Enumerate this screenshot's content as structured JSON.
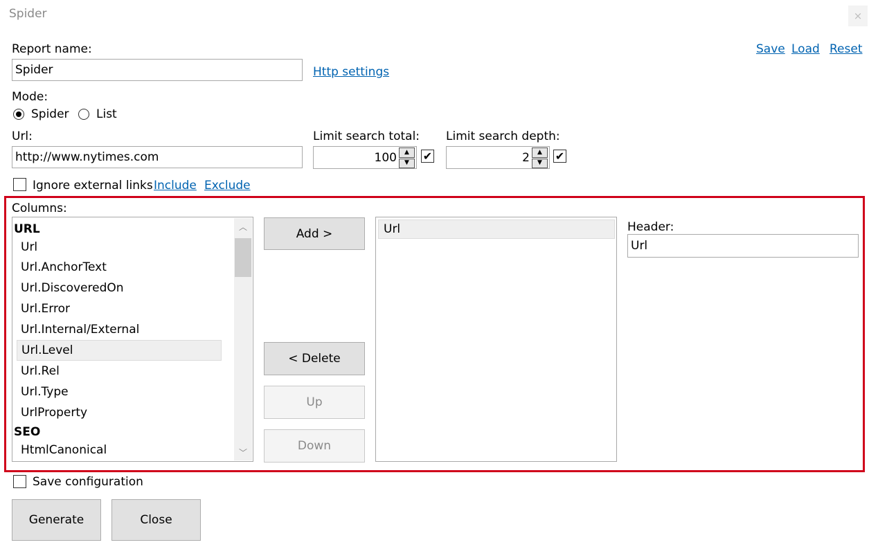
{
  "window": {
    "title": "Spider",
    "close_glyph": "×"
  },
  "top_links": {
    "save": "Save",
    "load": "Load",
    "reset": "Reset"
  },
  "report": {
    "label": "Report name:",
    "value": "Spider",
    "http_settings": "Http settings"
  },
  "mode": {
    "label": "Mode:",
    "options": [
      "Spider",
      "List"
    ],
    "selected": "Spider"
  },
  "url": {
    "label": "Url:",
    "value": "http://www.nytimes.com"
  },
  "limit_total": {
    "label": "Limit search total:",
    "value": "100",
    "checked": true
  },
  "limit_depth": {
    "label": "Limit search depth:",
    "value": "2",
    "checked": true
  },
  "external": {
    "label": "Ignore external links",
    "checked": false,
    "include": "Include",
    "exclude": "Exclude"
  },
  "columns": {
    "label": "Columns:",
    "groups": [
      {
        "name": "URL",
        "items": [
          "Url",
          "Url.AnchorText",
          "Url.DiscoveredOn",
          "Url.Error",
          "Url.Internal/External",
          "Url.Level",
          "Url.Rel",
          "Url.Type",
          "UrlProperty"
        ]
      },
      {
        "name": "SEO",
        "items": [
          "HtmlCanonical"
        ]
      }
    ],
    "selected_item": "Url.Level"
  },
  "buttons": {
    "add": "Add >",
    "delete": "< Delete",
    "up": "Up",
    "down": "Down"
  },
  "selected_columns": [
    "Url"
  ],
  "header": {
    "label": "Header:",
    "value": "Url"
  },
  "save_config": {
    "label": "Save configuration",
    "checked": false
  },
  "footer": {
    "generate": "Generate",
    "close": "Close"
  },
  "colors": {
    "link": "#0063b1",
    "highlight_border": "#d0021b"
  }
}
